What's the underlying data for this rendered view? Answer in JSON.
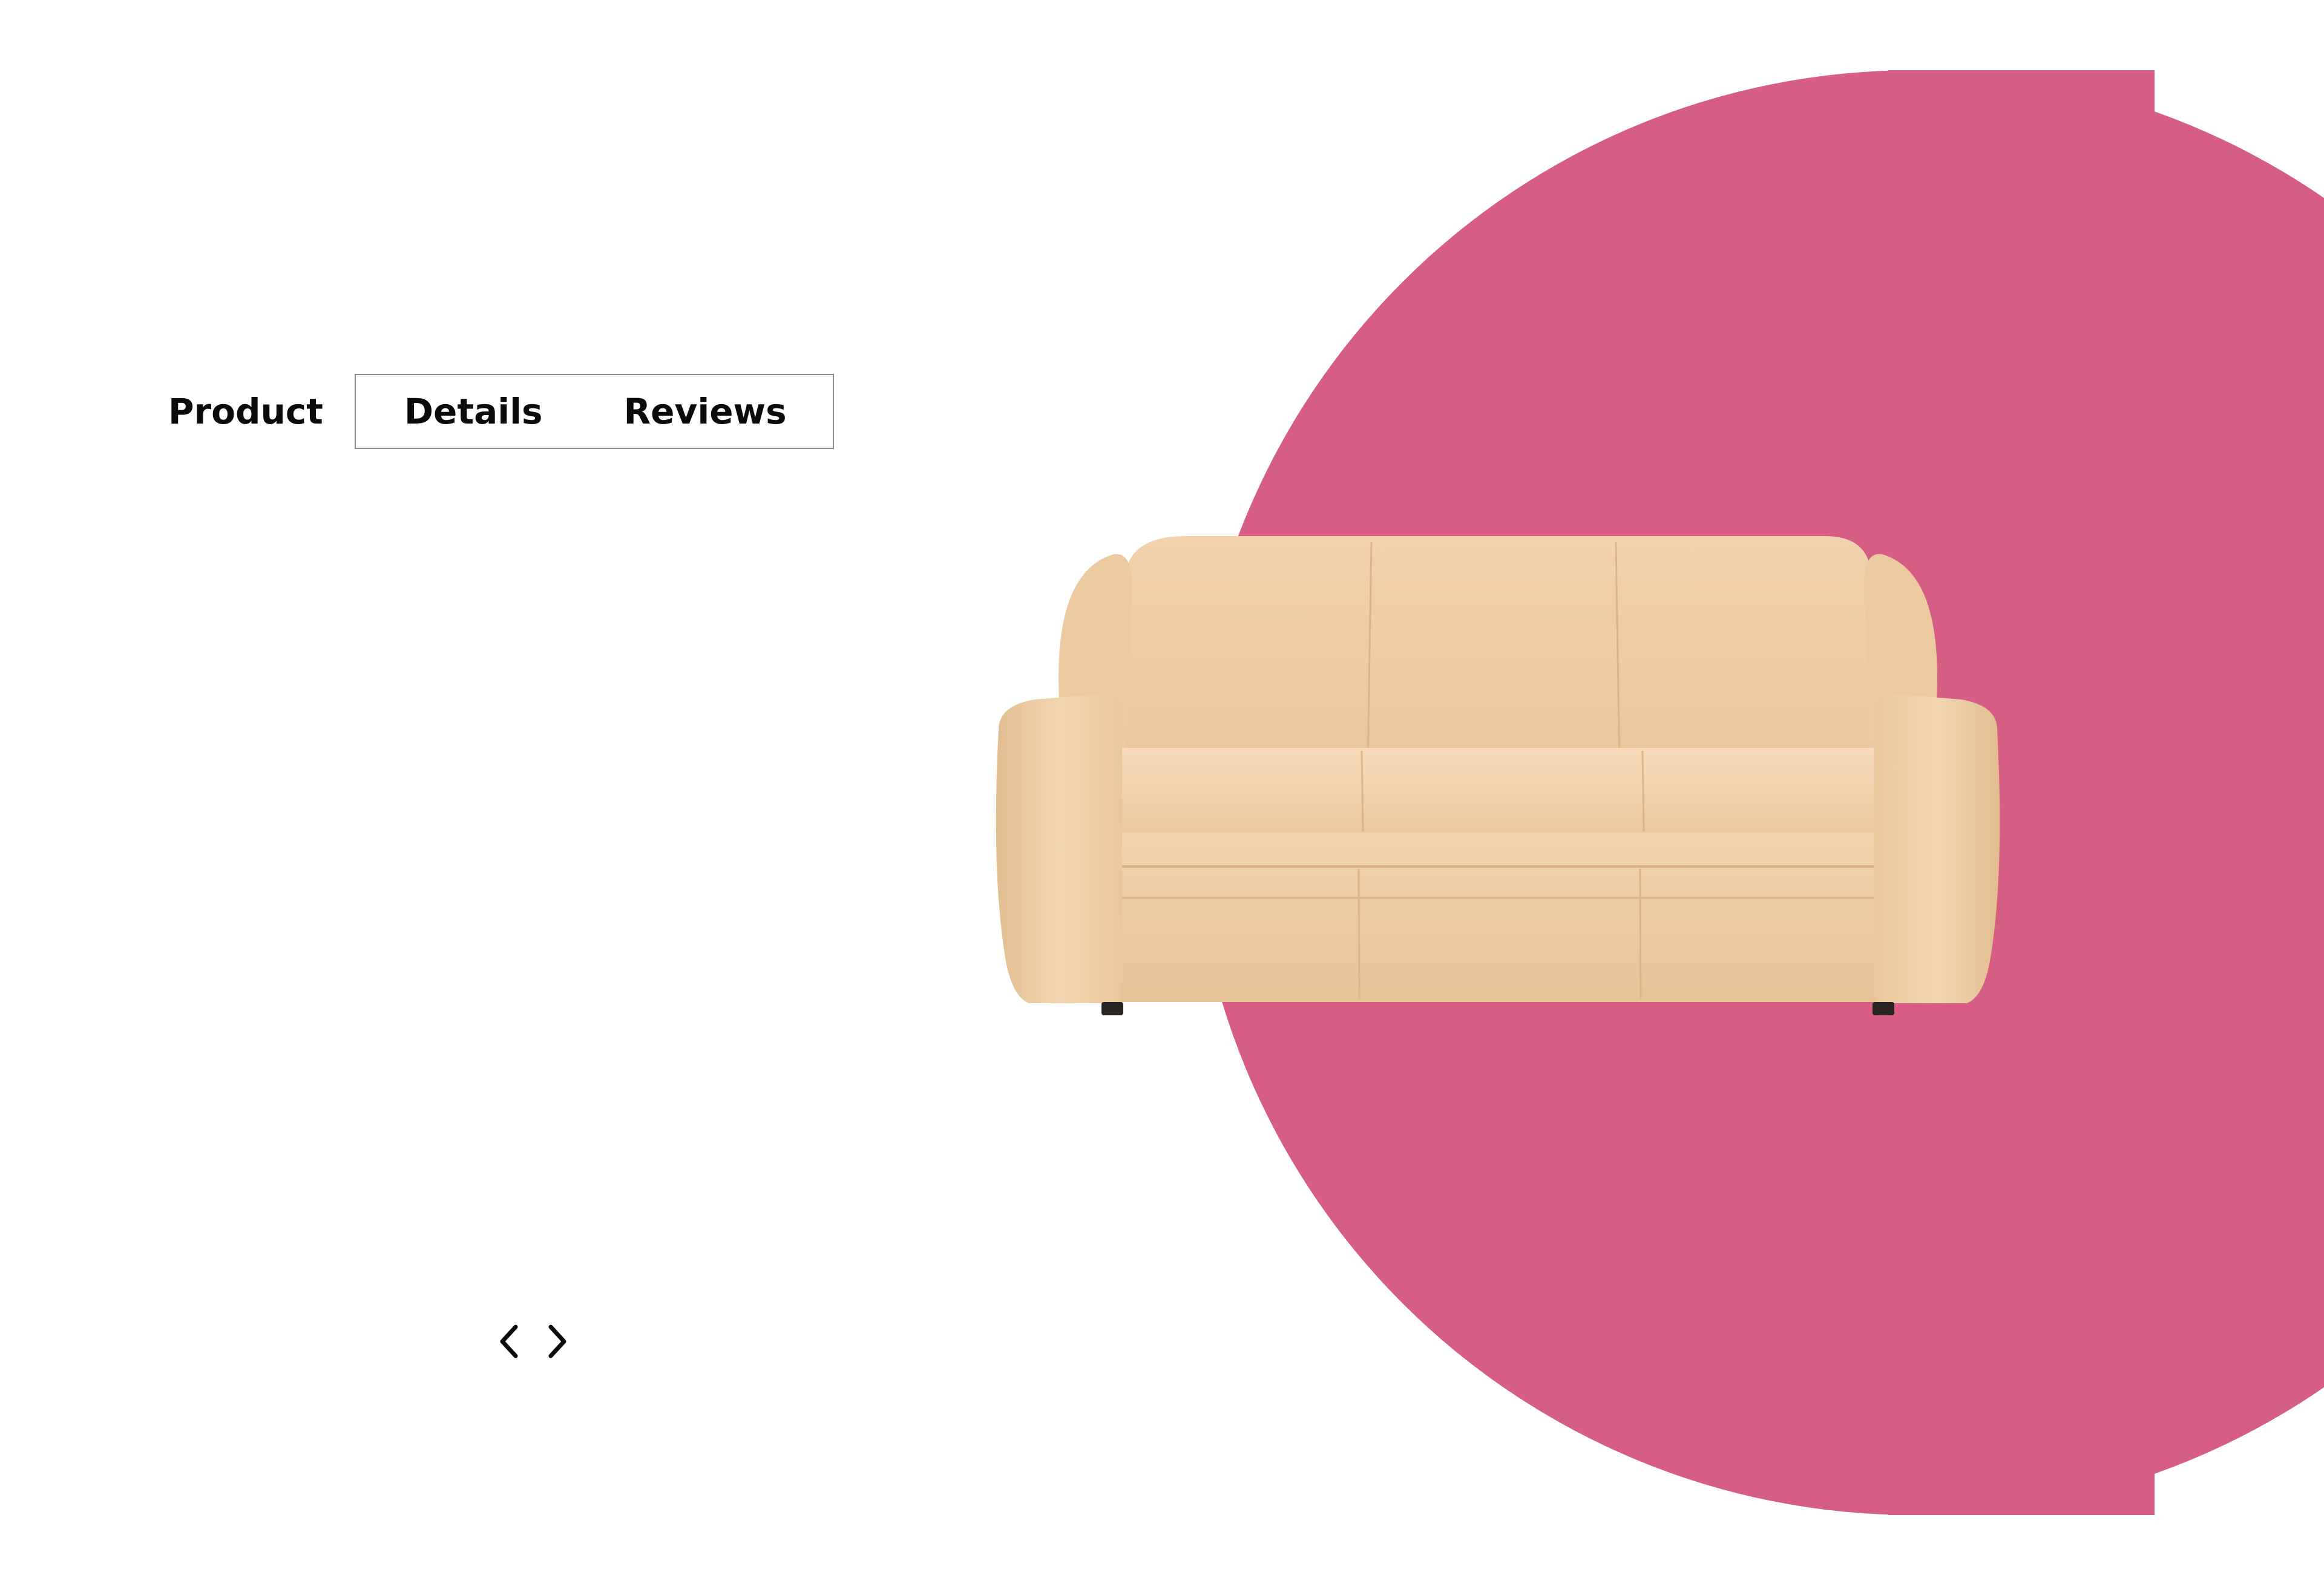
{
  "colors": {
    "accent_pink": "#d65d83",
    "text": "#0b0b0b",
    "tab_border": "#8a8a8a",
    "sofa_leather": "#eccba0"
  },
  "tabs": [
    {
      "label": "Product"
    },
    {
      "label": "Details"
    },
    {
      "label": "Reviews"
    }
  ],
  "carousel": {
    "prev_icon": "chevron-left-icon",
    "next_icon": "chevron-right-icon"
  },
  "hero_image": {
    "subject": "sofa"
  }
}
